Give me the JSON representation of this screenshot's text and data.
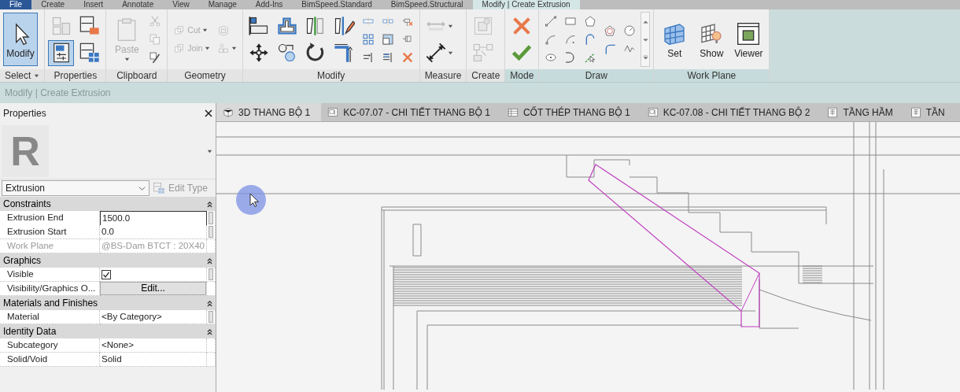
{
  "menu_tabs": [
    {
      "label": "File",
      "kind": "file",
      "selected": false
    },
    {
      "label": "Create",
      "kind": "tab",
      "selected": false
    },
    {
      "label": "Insert",
      "kind": "tab",
      "selected": false
    },
    {
      "label": "Annotate",
      "kind": "tab",
      "selected": false
    },
    {
      "label": "View",
      "kind": "tab",
      "selected": false
    },
    {
      "label": "Manage",
      "kind": "tab",
      "selected": false
    },
    {
      "label": "Add-Ins",
      "kind": "tab",
      "selected": false
    },
    {
      "label": "BimSpeed.Standard",
      "kind": "tab",
      "selected": false
    },
    {
      "label": "BimSpeed.Structural",
      "kind": "tab",
      "selected": false
    },
    {
      "label": "Modify | Create Extrusion",
      "kind": "tab",
      "selected": true
    }
  ],
  "ribbon_panels": [
    {
      "title": "Select",
      "title_dropdown": true,
      "contextual": false,
      "stacks": [
        [
          {
            "label": "Modify",
            "selected": true,
            "disabled": false
          }
        ]
      ]
    },
    {
      "title": "Properties",
      "title_dropdown": false,
      "contextual": false,
      "stacks": [
        [
          {
            "selected": false,
            "disabled": true
          },
          {
            "selected": true,
            "disabled": false
          }
        ],
        [
          {
            "selected": false,
            "disabled": false
          },
          {
            "selected": false,
            "disabled": false
          }
        ]
      ]
    },
    {
      "title": "Clipboard",
      "title_dropdown": false,
      "contextual": false,
      "stacks": [
        [
          {
            "label": "Paste",
            "dropdown": true,
            "selected": false,
            "disabled": true
          }
        ],
        [
          {
            "selected": false,
            "disabled": true
          },
          {
            "selected": false,
            "disabled": true
          },
          {
            "selected": false,
            "disabled": false
          }
        ]
      ]
    },
    {
      "title": "Geometry",
      "title_dropdown": false,
      "contextual": false,
      "stacks": [
        [
          {
            "label": "Cut",
            "dropdown": true,
            "selected": false,
            "disabled": true
          },
          {
            "label": "Join",
            "dropdown": true,
            "selected": false,
            "disabled": true
          }
        ],
        [
          {
            "selected": false,
            "disabled": true
          },
          {
            "dropdown": true,
            "selected": false,
            "disabled": true
          }
        ]
      ]
    },
    {
      "title": "Modify",
      "title_dropdown": false,
      "contextual": false,
      "stacks": [
        [
          {
            "selected": false,
            "disabled": false
          },
          {
            "selected": false,
            "disabled": false
          }
        ],
        [
          {
            "selected": false,
            "disabled": false
          },
          {
            "selected": false,
            "disabled": false
          }
        ],
        [
          {
            "selected": false,
            "disabled": false
          },
          {
            "selected": false,
            "disabled": false
          }
        ],
        [
          {
            "selected": false,
            "disabled": false
          },
          {
            "selected": false,
            "disabled": false
          }
        ],
        [
          {
            "selected": false,
            "disabled": false
          },
          {
            "selected": false,
            "disabled": false
          },
          {
            "selected": false,
            "disabled": false
          }
        ],
        [
          {
            "selected": false,
            "disabled": false
          },
          {
            "selected": false,
            "disabled": false
          },
          {
            "selected": false,
            "disabled": false
          }
        ],
        [
          {
            "selected": false,
            "disabled": false
          },
          {
            "selected": false,
            "disabled": false
          },
          {
            "selected": false,
            "disabled": false
          }
        ]
      ]
    },
    {
      "title": "Measure",
      "title_dropdown": false,
      "contextual": false,
      "stacks": [
        [
          {
            "dropdown": true,
            "selected": false,
            "disabled": true
          },
          {
            "dropdown": true,
            "selected": false,
            "disabled": false
          }
        ]
      ]
    },
    {
      "title": "Create",
      "title_dropdown": false,
      "contextual": false,
      "stacks": [
        [
          {
            "selected": false,
            "disabled": true
          },
          {
            "selected": false,
            "disabled": true
          }
        ]
      ]
    },
    {
      "title": "Mode",
      "title_dropdown": false,
      "contextual": true,
      "stacks": [
        [
          {
            "selected": false,
            "disabled": false
          },
          {
            "selected": false,
            "disabled": false
          }
        ]
      ]
    },
    {
      "title": "Draw",
      "title_dropdown": false,
      "contextual": true,
      "stacks": [
        [
          {
            "selected": false,
            "disabled": false
          },
          {
            "selected": false,
            "disabled": false
          },
          {
            "selected": false,
            "disabled": false
          }
        ],
        [
          {
            "selected": false,
            "disabled": false
          },
          {
            "selected": false,
            "disabled": false
          },
          {
            "selected": false,
            "disabled": false
          }
        ],
        [
          {
            "selected": false,
            "disabled": false
          },
          {
            "selected": false,
            "disabled": false
          },
          {
            "selected": false,
            "disabled": false
          }
        ],
        [
          {
            "selected": false,
            "disabled": false
          },
          {
            "selected": false,
            "disabled": false
          }
        ],
        [
          {
            "selected": false,
            "disabled": false
          },
          {
            "selected": false,
            "disabled": false
          }
        ]
      ]
    },
    {
      "title": "Work Plane",
      "title_dropdown": false,
      "contextual": true,
      "stacks": [
        [
          {
            "label": "Set",
            "selected": false,
            "disabled": false
          }
        ],
        [
          {
            "label": "Show",
            "selected": false,
            "disabled": false
          }
        ],
        [
          {
            "label": "Viewer",
            "selected": false,
            "disabled": false
          }
        ]
      ]
    }
  ],
  "context_bar": {
    "text": "Modify | Create Extrusion"
  },
  "properties": {
    "title": "Properties",
    "logo_letter": "R",
    "type": "Extrusion",
    "edit_type": {
      "label": "Edit Type",
      "disabled": true
    },
    "groups": [
      {
        "name": "Constraints",
        "expanded": true,
        "rows": [
          {
            "name": "Extrusion End",
            "value": "1500.0",
            "kind": "input",
            "disabled": false
          },
          {
            "name": "Extrusion Start",
            "value": "0.0",
            "kind": "text",
            "disabled": false
          },
          {
            "name": "Work Plane",
            "value": "@BS-Dam BTCT : 20X40",
            "kind": "text",
            "disabled": true
          }
        ]
      },
      {
        "name": "Graphics",
        "expanded": true,
        "rows": [
          {
            "name": "Visible",
            "kind": "checkbox",
            "checked": true,
            "disabled": false
          },
          {
            "name": "Visibility/Graphics O...",
            "value": "Edit...",
            "kind": "button",
            "disabled": false
          }
        ]
      },
      {
        "name": "Materials and Finishes",
        "expanded": true,
        "rows": [
          {
            "name": "Material",
            "value": "<By Category>",
            "kind": "text",
            "disabled": false
          }
        ]
      },
      {
        "name": "Identity Data",
        "expanded": true,
        "rows": [
          {
            "name": "Subcategory",
            "value": "<None>",
            "kind": "text",
            "disabled": false
          },
          {
            "name": "Solid/Void",
            "value": "Solid",
            "kind": "text",
            "disabled": false
          }
        ]
      }
    ]
  },
  "view_tabs": [
    {
      "label": "3D THANG BỘ 1",
      "selected": true
    },
    {
      "label": "KC-07.07 - CHI TIẾT THANG BỘ 1",
      "selected": false
    },
    {
      "label": "CỐT THÉP THANG BỘ 1",
      "selected": false
    },
    {
      "label": "KC-07.08 - CHI TIẾT THANG BỘ 2",
      "selected": false
    },
    {
      "label": "TẦNG HẦM",
      "selected": false
    },
    {
      "label": "TẦN",
      "selected": false
    }
  ]
}
